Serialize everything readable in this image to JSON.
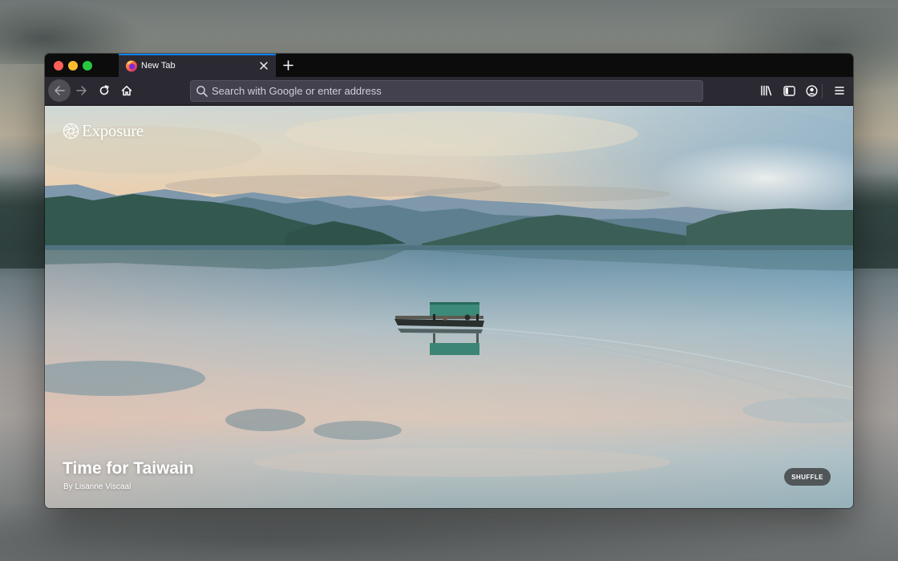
{
  "browser": {
    "tab": {
      "title": "New Tab",
      "favicon": "firefox-icon",
      "close_icon": "close-icon"
    },
    "new_tab_icon": "plus-icon",
    "toolbar": {
      "back_icon": "arrow-left-icon",
      "forward_icon": "arrow-right-icon",
      "reload_icon": "reload-icon",
      "home_icon": "home-icon",
      "library_icon": "library-icon",
      "sidebar_icon": "sidebar-icon",
      "account_icon": "account-icon",
      "menu_icon": "hamburger-menu-icon"
    },
    "urlbar": {
      "placeholder": "Search with Google or enter address",
      "value": "",
      "search_icon": "search-icon"
    },
    "accent_color": "#0a84ff"
  },
  "newtab": {
    "brand": {
      "name": "Exposure",
      "logo_icon": "aperture-icon"
    },
    "photo": {
      "title": "Time for Taiwain",
      "author": "By Lisanne Viscaal"
    },
    "shuffle_label": "SHUFFLE"
  }
}
